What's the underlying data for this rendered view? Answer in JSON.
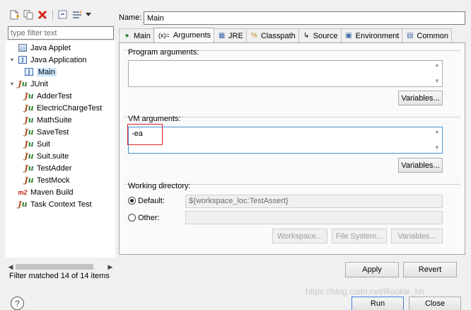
{
  "left": {
    "toolbar": [
      "new-config-icon",
      "duplicate-icon",
      "delete-icon",
      "collapse-all-icon",
      "filter-icon"
    ],
    "filter_placeholder": "type filter text",
    "tree": [
      {
        "label": "Java Applet",
        "icon": "applet",
        "level": 0,
        "expand": ""
      },
      {
        "label": "Java Application",
        "icon": "japp",
        "level": 0,
        "expand": "▾"
      },
      {
        "label": "Main",
        "icon": "japp",
        "level": 1,
        "expand": "",
        "selected": true
      },
      {
        "label": "JUnit",
        "icon": "junit",
        "level": 0,
        "expand": "▾"
      },
      {
        "label": "AdderTest",
        "icon": "junit",
        "level": 1,
        "expand": ""
      },
      {
        "label": "ElectricChargeTest",
        "icon": "junit",
        "level": 1,
        "expand": ""
      },
      {
        "label": "MathSuite",
        "icon": "junit",
        "level": 1,
        "expand": ""
      },
      {
        "label": "SaveTest",
        "icon": "junit",
        "level": 1,
        "expand": ""
      },
      {
        "label": "Suit",
        "icon": "junit",
        "level": 1,
        "expand": ""
      },
      {
        "label": "Suit.suite",
        "icon": "junit",
        "level": 1,
        "expand": ""
      },
      {
        "label": "TestAdder",
        "icon": "junit",
        "level": 1,
        "expand": ""
      },
      {
        "label": "TestMock",
        "icon": "junit",
        "level": 1,
        "expand": ""
      },
      {
        "label": "Maven Build",
        "icon": "m2",
        "level": 0,
        "expand": ""
      },
      {
        "label": "Task Context Test",
        "icon": "junit",
        "level": 0,
        "expand": ""
      }
    ],
    "status": "Filter matched 14 of 14 items"
  },
  "right": {
    "name_label": "Name:",
    "name_value": "Main",
    "tabs": [
      {
        "label": "Main",
        "icon": "main-tab-icon",
        "glyph": "●"
      },
      {
        "label": "Arguments",
        "icon": "arguments-tab-icon",
        "glyph": "(x)=",
        "active": true
      },
      {
        "label": "JRE",
        "icon": "jre-tab-icon",
        "glyph": "▦"
      },
      {
        "label": "Classpath",
        "icon": "classpath-tab-icon",
        "glyph": "%"
      },
      {
        "label": "Source",
        "icon": "source-tab-icon",
        "glyph": "↳"
      },
      {
        "label": "Environment",
        "icon": "environment-tab-icon",
        "glyph": "▣"
      },
      {
        "label": "Common",
        "icon": "common-tab-icon",
        "glyph": "▤"
      }
    ],
    "program_args": {
      "title": "Program arguments:",
      "value": "",
      "variables": "Variables..."
    },
    "vm_args": {
      "title": "VM arguments:",
      "value": "-ea",
      "variables": "Variables..."
    },
    "working_dir": {
      "title": "Working directory:",
      "default_label": "Default:",
      "default_value": "${workspace_loc:TestAssert}",
      "other_label": "Other:",
      "other_value": "",
      "workspace_btn": "Workspace...",
      "filesystem_btn": "File System...",
      "variables_btn": "Variables..."
    },
    "apply": "Apply",
    "revert": "Revert"
  },
  "bottom": {
    "run": "Run",
    "close": "Close"
  },
  "watermark": "https://blog.csdn.net/Rookie_hh",
  "colors": {
    "highlight": "#e0262a",
    "selection": "#cce8ff"
  }
}
